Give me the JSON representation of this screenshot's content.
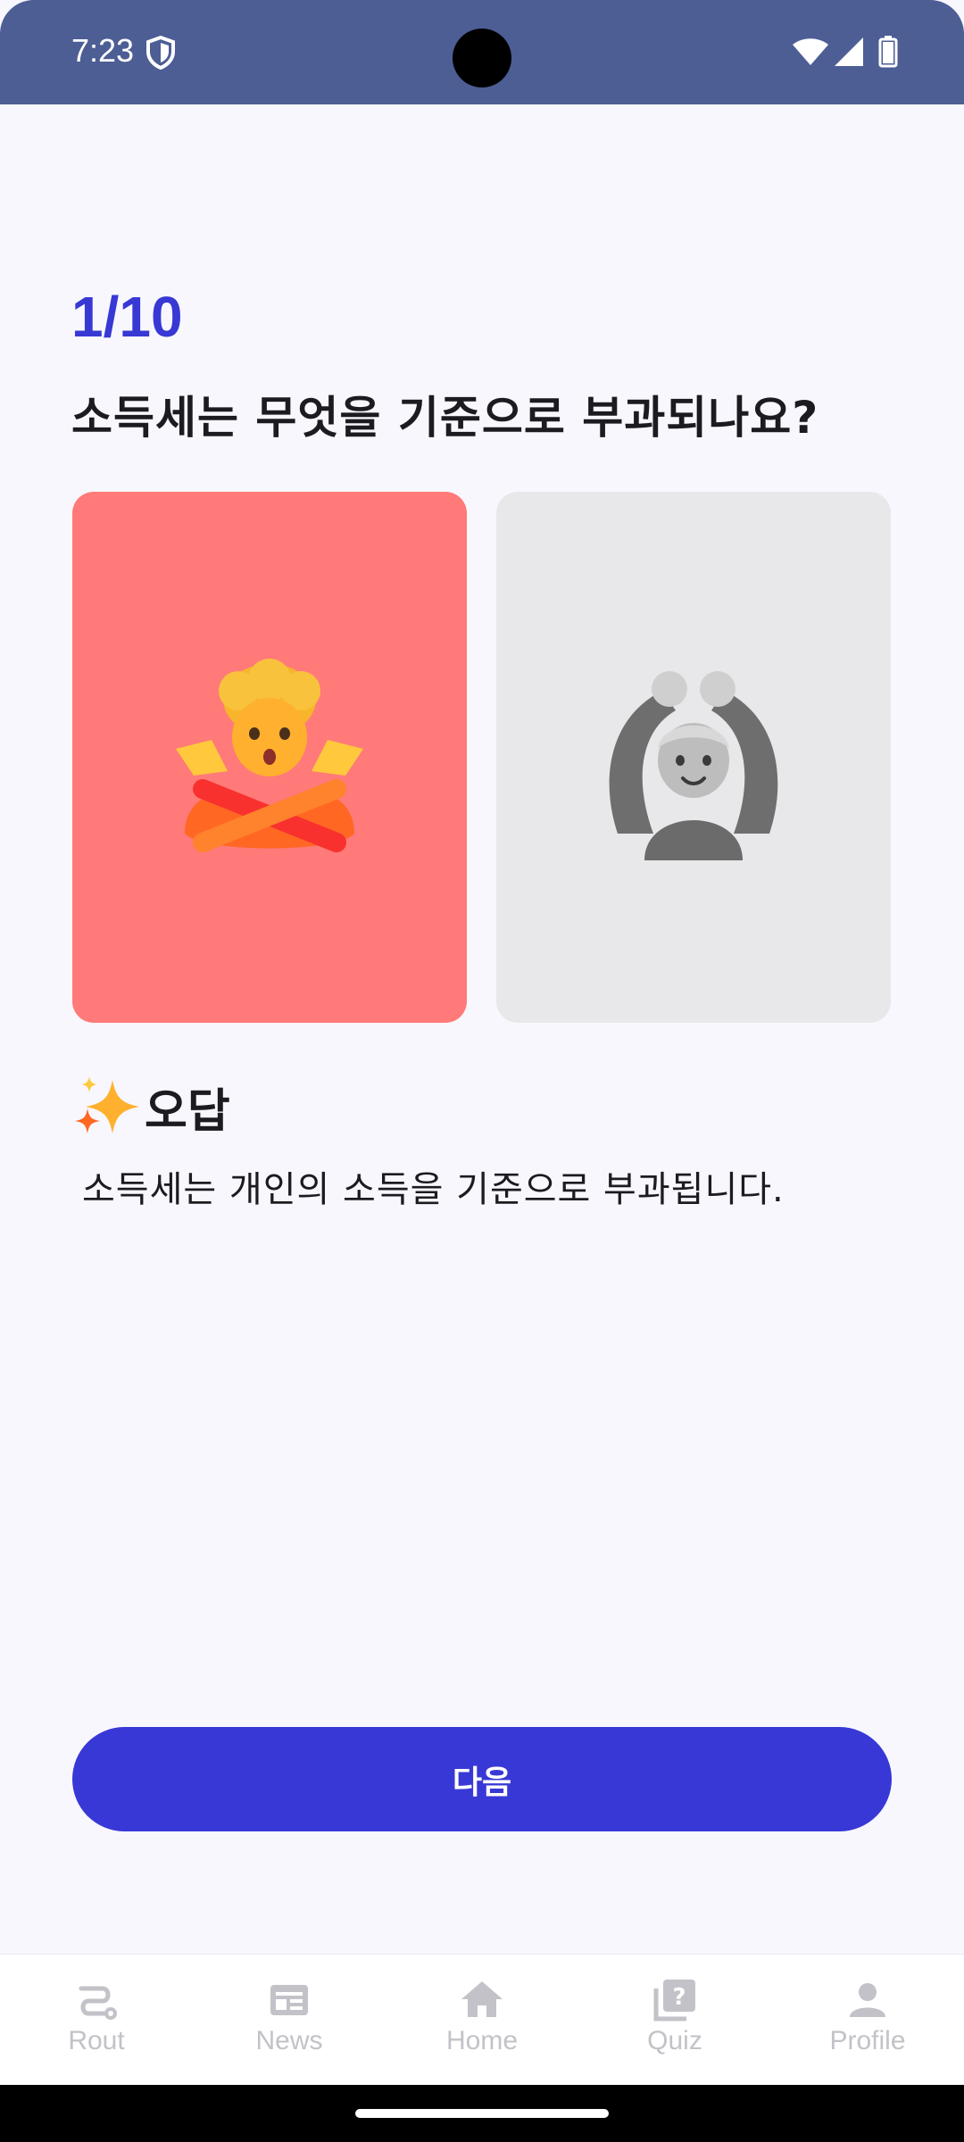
{
  "status_bar": {
    "time": "7:23",
    "icons": [
      "shield-icon",
      "wifi-icon",
      "signal-icon",
      "battery-icon"
    ],
    "background": "#4C5E94"
  },
  "quiz": {
    "progress": "1/10",
    "question": "소득세는 무엇을 기준으로 부과되나요?",
    "options": [
      {
        "name": "x-option",
        "emoji": "person-gesturing-no",
        "state": "selected-wrong",
        "color": "#FF7A78"
      },
      {
        "name": "o-option",
        "emoji": "person-gesturing-ok",
        "state": "unselected",
        "color": "#E8E8EA"
      }
    ],
    "result_icon": "sparkles-icon",
    "result_label": "오답",
    "explanation": "소득세는 개인의 소득을 기준으로 부과됩니다.",
    "next_button_label": "다음",
    "accent_color": "#3838D6"
  },
  "bottom_nav": {
    "items": [
      {
        "label": "Rout",
        "icon": "route-icon"
      },
      {
        "label": "News",
        "icon": "news-icon"
      },
      {
        "label": "Home",
        "icon": "home-icon"
      },
      {
        "label": "Quiz",
        "icon": "quiz-icon"
      },
      {
        "label": "Profile",
        "icon": "profile-icon"
      }
    ],
    "inactive_color": "#C2C2C8"
  }
}
